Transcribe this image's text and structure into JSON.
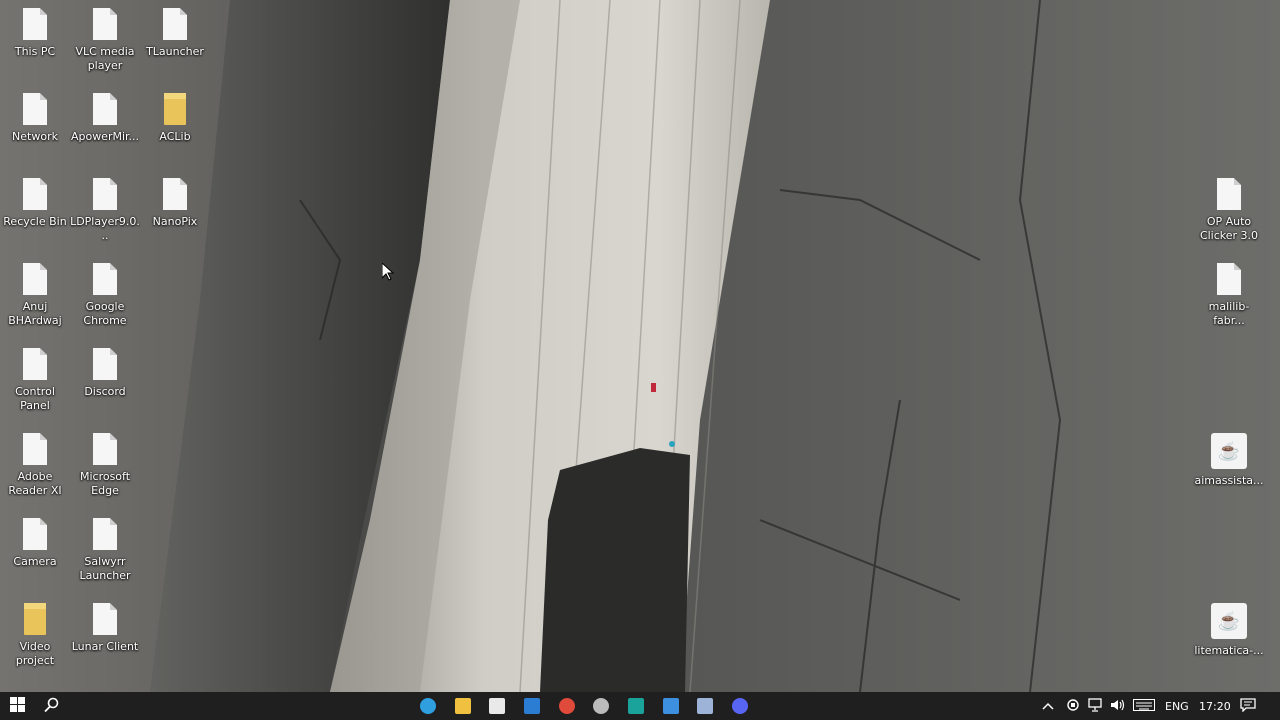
{
  "desktop": {
    "left_icons": [
      {
        "label": "This PC",
        "kind": "file"
      },
      {
        "label": "VLC media player",
        "kind": "file"
      },
      {
        "label": "TLauncher",
        "kind": "file"
      },
      {
        "label": "Network",
        "kind": "file"
      },
      {
        "label": "ApowerMir...",
        "kind": "file"
      },
      {
        "label": "ACLib",
        "kind": "folder"
      },
      {
        "label": "Recycle Bin",
        "kind": "file"
      },
      {
        "label": "LDPlayer9.0...",
        "kind": "file"
      },
      {
        "label": "NanoPix",
        "kind": "file"
      },
      {
        "label": "Anuj BHArdwaj",
        "kind": "file"
      },
      {
        "label": "Google Chrome",
        "kind": "file"
      },
      {
        "label": "Control Panel",
        "kind": "file"
      },
      {
        "label": "Discord",
        "kind": "file"
      },
      {
        "label": "Adobe Reader XI",
        "kind": "file"
      },
      {
        "label": "Microsoft Edge",
        "kind": "file"
      },
      {
        "label": "Camera",
        "kind": "file"
      },
      {
        "label": "Salwyrr Launcher",
        "kind": "file"
      },
      {
        "label": "Video project",
        "kind": "folder"
      },
      {
        "label": "Lunar Client",
        "kind": "file"
      }
    ],
    "right_icons": [
      {
        "label": "OP Auto Clicker 3.0",
        "kind": "file"
      },
      {
        "label": "malilib-fabr...",
        "kind": "file"
      },
      {
        "label": "aimassista...",
        "kind": "java"
      },
      {
        "label": "litematica-...",
        "kind": "java"
      }
    ]
  },
  "taskbar": {
    "start_icon": "windows-logo-icon",
    "search_icon": "search-icon",
    "pinned_apps": [
      {
        "name": "edge",
        "icon": "edge-icon",
        "color": "#2f9fe0"
      },
      {
        "name": "file-explorer",
        "icon": "folder-icon",
        "color": "#f0c040"
      },
      {
        "name": "store",
        "icon": "store-icon",
        "color": "#e9e9e9"
      },
      {
        "name": "word",
        "icon": "word-icon",
        "color": "#2b7cd3"
      },
      {
        "name": "chrome",
        "icon": "chrome-icon",
        "color": "#e04a3a"
      },
      {
        "name": "app-circle",
        "icon": "steering-icon",
        "color": "#bbbbbb"
      },
      {
        "name": "teal-app",
        "icon": "teal-app-icon",
        "color": "#1aa39a"
      },
      {
        "name": "blue-app",
        "icon": "window-app-icon",
        "color": "#3d8fe0"
      },
      {
        "name": "camera",
        "icon": "camera-icon",
        "color": "#9db4d8"
      },
      {
        "name": "discord",
        "icon": "discord-icon",
        "color": "#5865f2"
      }
    ],
    "tray": {
      "language": "ENG",
      "time": "17:20"
    }
  }
}
